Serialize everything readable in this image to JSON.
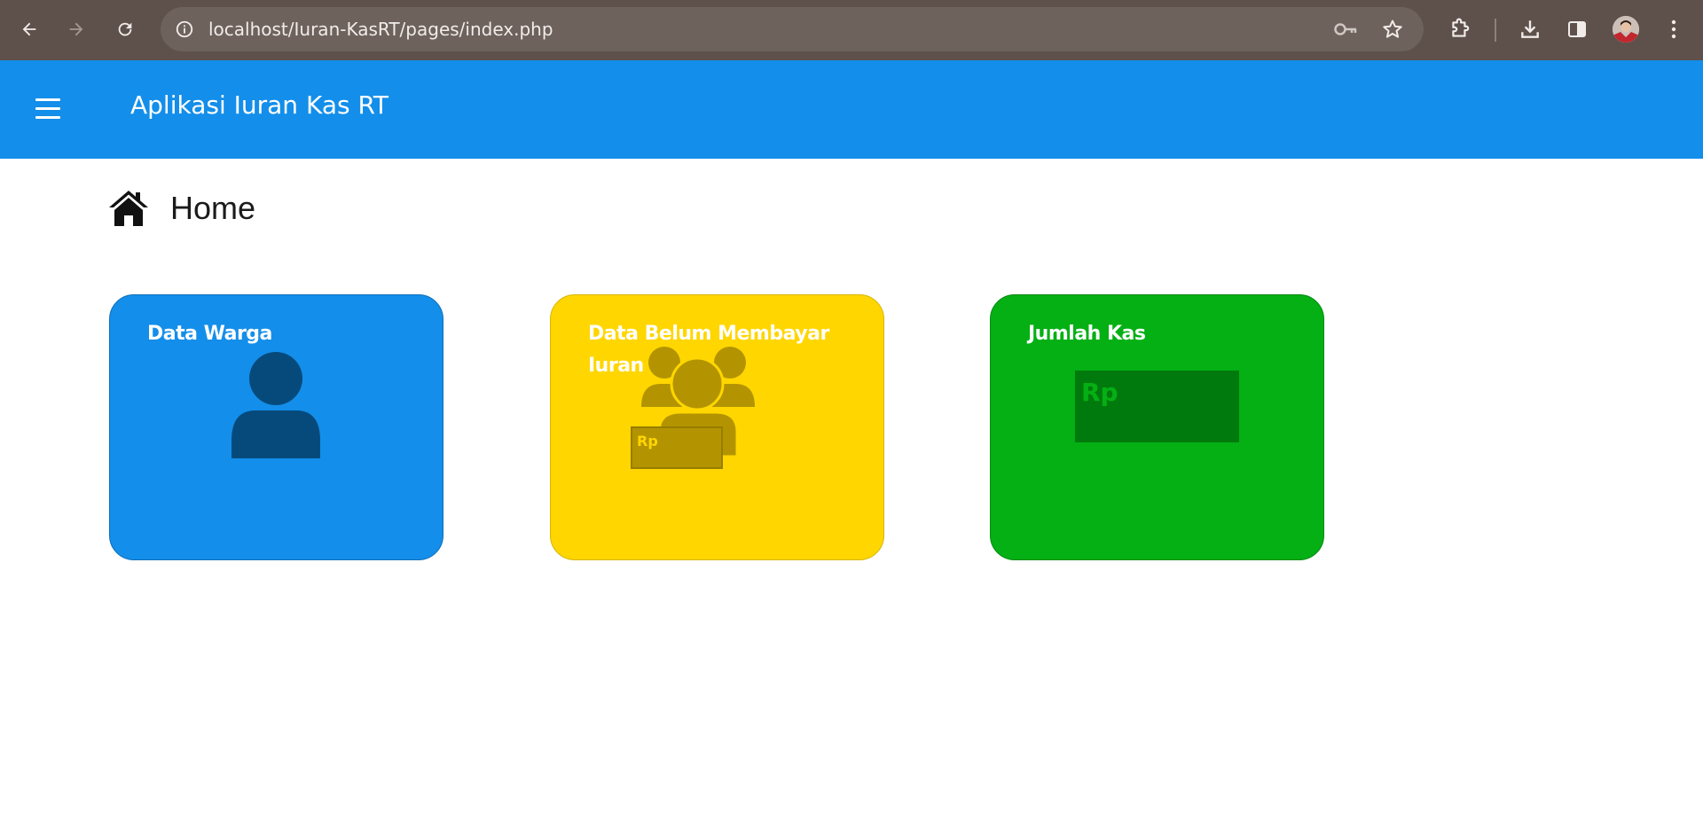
{
  "browser": {
    "url": "localhost/Iuran-KasRT/pages/index.php"
  },
  "header": {
    "app_title": "Aplikasi Iuran Kas RT"
  },
  "page": {
    "title": "Home"
  },
  "cards": [
    {
      "title": "Data Warga",
      "color": "#138eea",
      "icon": "user-icon"
    },
    {
      "title": "Data Belum Membayar Iuran",
      "color": "#ffd600",
      "icon": "users-money-icon",
      "badge": "Rp"
    },
    {
      "title": "Jumlah Kas",
      "color": "#04b014",
      "icon": "money-icon",
      "badge": "Rp"
    }
  ],
  "colors": {
    "browser_frame": "#5e514b",
    "header": "#138eea"
  }
}
